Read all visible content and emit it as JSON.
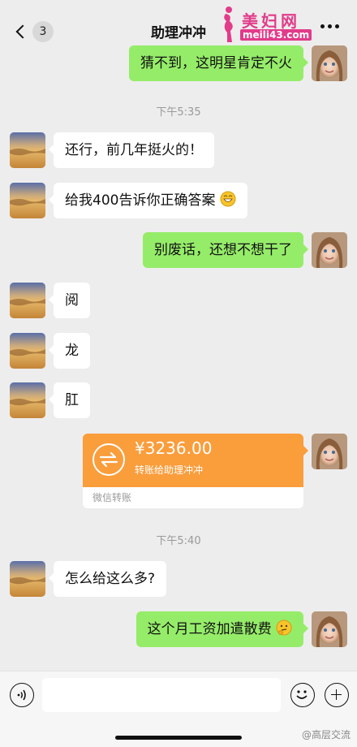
{
  "header": {
    "back_icon": "chevron-left-icon",
    "unread_count": "3",
    "title": "助理冲冲",
    "more_icon": "more-dots-icon"
  },
  "watermark": {
    "brand_cn": "美妇网",
    "brand_url": "meili43.com"
  },
  "messages": [
    {
      "side": "right",
      "text": "猜不到，这明星肯定不火"
    },
    {
      "side": "left",
      "text": "还行，前几年挺火的！"
    },
    {
      "side": "left",
      "text": "给我400告诉你正确答案",
      "emoji": "grin-emoji"
    },
    {
      "side": "right",
      "text": "别废话，还想不想干了"
    },
    {
      "side": "left",
      "text": "阅"
    },
    {
      "side": "left",
      "text": "龙"
    },
    {
      "side": "left",
      "text": "肛"
    },
    {
      "side": "left",
      "text": "怎么给这么多?"
    },
    {
      "side": "right",
      "text": "这个月工资加遣散费",
      "emoji": "thinking-emoji"
    }
  ],
  "timestamps": [
    "下午5:35",
    "下午5:40"
  ],
  "transfer": {
    "amount": "¥3236.00",
    "description": "转账给助理冲冲",
    "footer": "微信转账",
    "color": "#fa9d3b"
  },
  "input_bar": {
    "placeholder": "",
    "voice_icon": "voice-icon",
    "emoji_icon": "emoji-icon",
    "plus_icon": "plus-icon"
  },
  "footer_watermark": "@高层交流",
  "colors": {
    "background": "#ededed",
    "self_bubble": "#95ec69",
    "other_bubble": "#ffffff",
    "brand": "#e23b8a"
  }
}
